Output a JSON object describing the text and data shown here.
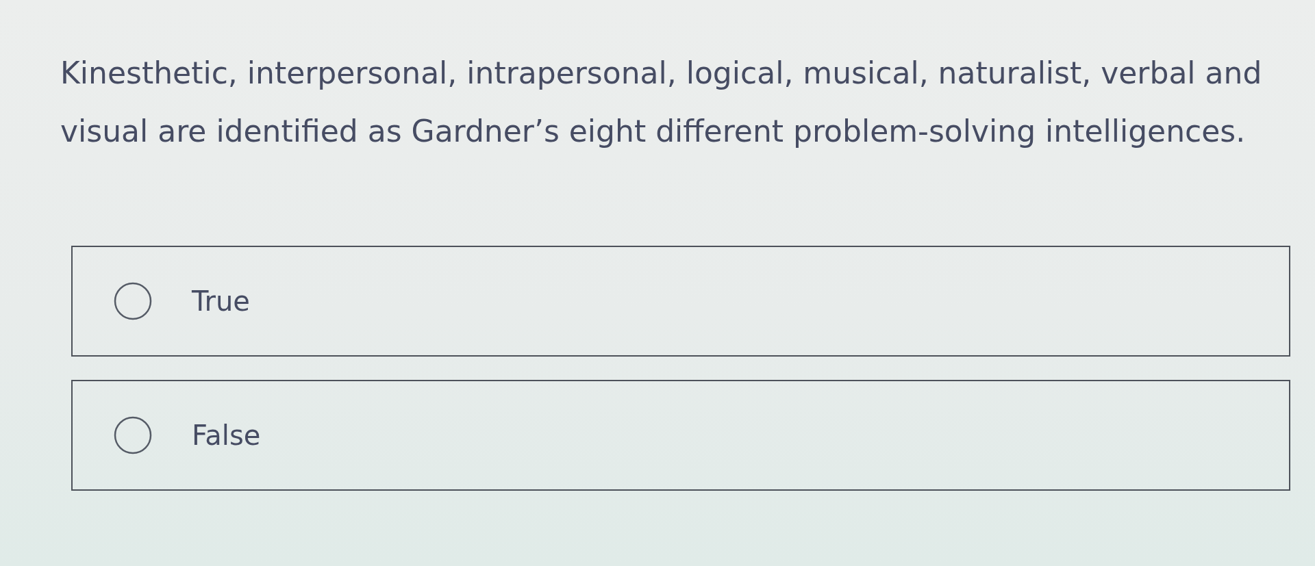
{
  "question": {
    "text": "Kinesthetic, interpersonal, intrapersonal, logical, musical, naturalist, verbal and visual are identified as Gardner’s eight different problem-solving intelligences."
  },
  "options": [
    {
      "label": "True",
      "selected": false
    },
    {
      "label": "False",
      "selected": false
    }
  ]
}
